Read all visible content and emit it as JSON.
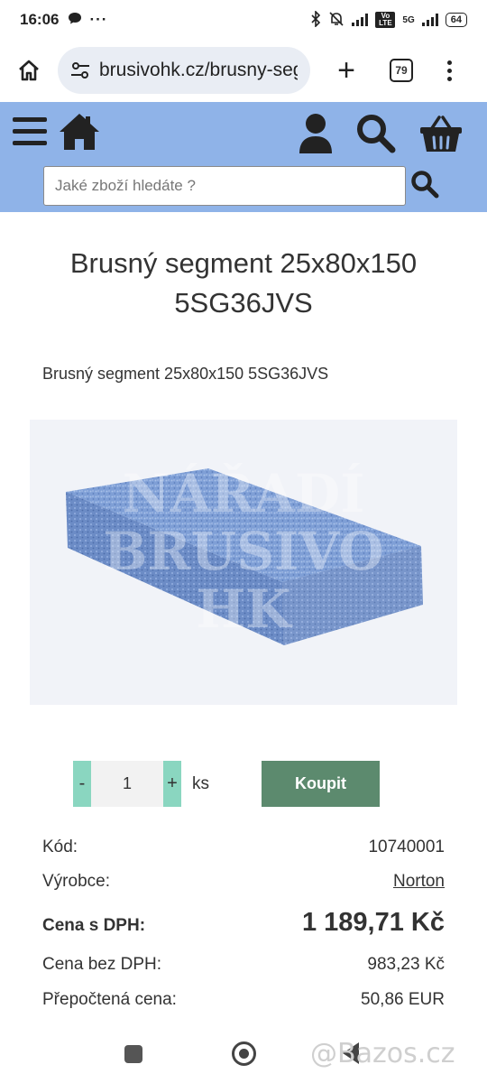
{
  "status_bar": {
    "time": "16:06",
    "battery": "64",
    "network": "5G",
    "volte": "Vo LTE"
  },
  "browser": {
    "url": "brusivohk.cz/brusny-seg",
    "tab_count": "79"
  },
  "site_header": {
    "search_placeholder": "Jaké zboží hledáte ?"
  },
  "product": {
    "title": "Brusný segment 25x80x150 5SG36JVS",
    "subtitle": "Brusný segment 25x80x150 5SG36JVS",
    "image_watermark": [
      "NÁŘADÍ",
      "BRUSIVO",
      "HK"
    ]
  },
  "purchase": {
    "minus": "-",
    "plus": "+",
    "quantity": "1",
    "unit": "ks",
    "buy_label": "Koupit"
  },
  "details": {
    "code_label": "Kód:",
    "code_value": "10740001",
    "maker_label": "Výrobce:",
    "maker_value": "Norton",
    "price_vat_label": "Cena s DPH:",
    "price_vat_value": "1 189,71 Kč",
    "price_novat_label": "Cena bez DPH:",
    "price_novat_value": "983,23 Kč",
    "price_eur_label": "Přepočtená cena:",
    "price_eur_value": "50,86 EUR"
  },
  "watermark": "@Bazos.cz",
  "colors": {
    "header_bg": "#8fb3e8",
    "qty_accent": "#8ad6c0",
    "buy_button": "#5c8a6e"
  }
}
